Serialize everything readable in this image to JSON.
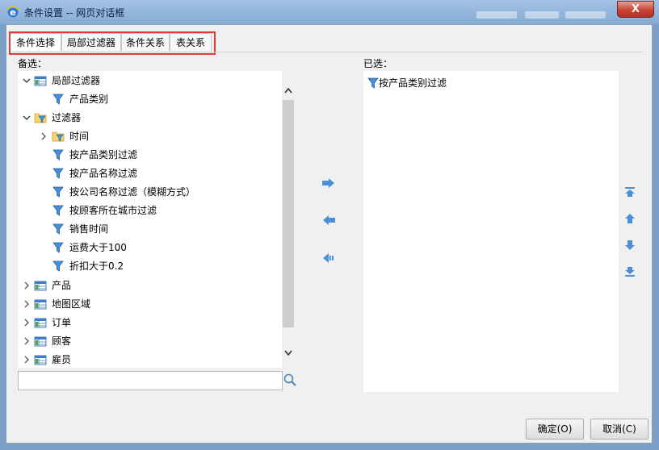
{
  "window": {
    "title": "条件设置 -- 网页对话框",
    "close_label": "X"
  },
  "tabs": [
    {
      "label": "条件选择",
      "active": true
    },
    {
      "label": "局部过滤器",
      "active": false
    },
    {
      "label": "条件关系",
      "active": false
    },
    {
      "label": "表关系",
      "active": false
    }
  ],
  "available": {
    "label": "备选：",
    "tree": [
      {
        "label": "局部过滤器",
        "icon": "table-icon",
        "expanded": true,
        "level": 0
      },
      {
        "label": "产品类别",
        "icon": "filter-icon",
        "level": 1
      },
      {
        "label": "过滤器",
        "icon": "filter-folder-icon",
        "expanded": true,
        "level": 0
      },
      {
        "label": "时间",
        "icon": "filter-folder-icon",
        "expanded": false,
        "level": 1
      },
      {
        "label": "按产品类别过滤",
        "icon": "filter-icon",
        "level": 1
      },
      {
        "label": "按产品名称过滤",
        "icon": "filter-icon",
        "level": 1
      },
      {
        "label": "按公司名称过滤（模糊方式）",
        "icon": "filter-icon",
        "level": 1
      },
      {
        "label": "按顾客所在城市过滤",
        "icon": "filter-icon",
        "level": 1
      },
      {
        "label": "销售时间",
        "icon": "filter-icon",
        "level": 1
      },
      {
        "label": "运费大于100",
        "icon": "filter-icon",
        "level": 1
      },
      {
        "label": "折扣大于0.2",
        "icon": "filter-icon",
        "level": 1
      },
      {
        "label": "产品",
        "icon": "table-icon",
        "expanded": false,
        "level": 0
      },
      {
        "label": "地图区域",
        "icon": "table-icon",
        "expanded": false,
        "level": 0
      },
      {
        "label": "订单",
        "icon": "table-icon",
        "expanded": false,
        "level": 0
      },
      {
        "label": "顾客",
        "icon": "table-icon",
        "expanded": false,
        "level": 0
      },
      {
        "label": "雇员",
        "icon": "table-icon",
        "expanded": false,
        "level": 0
      }
    ],
    "search_value": ""
  },
  "selected": {
    "label": "已选：",
    "items": [
      {
        "label": "按产品类别过滤",
        "icon": "filter-icon"
      }
    ]
  },
  "buttons": {
    "ok": "确定(O)",
    "cancel": "取消(C)"
  },
  "colors": {
    "accent_blue": "#4a90d9",
    "highlight_red": "#e53935"
  }
}
